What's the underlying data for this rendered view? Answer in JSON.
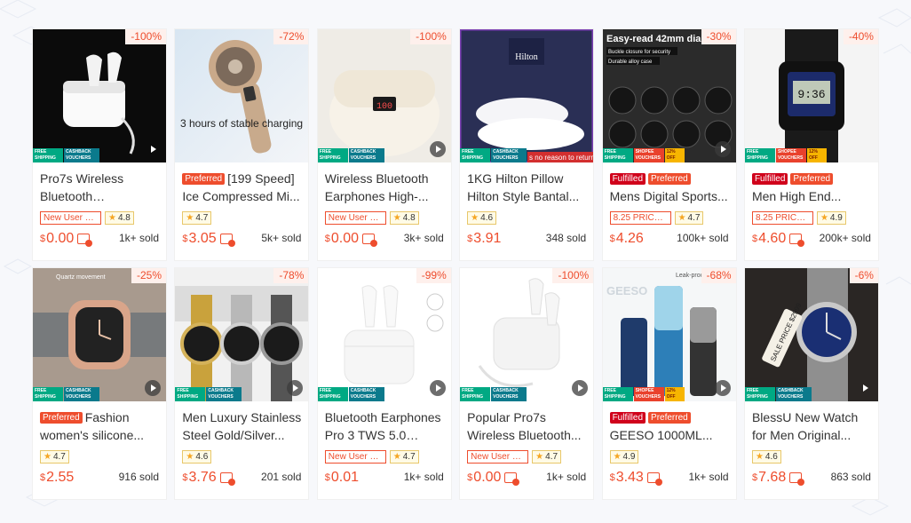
{
  "strip": {
    "s1": "FREE SHIPPING",
    "s2": "CASHBACK VOUCHERS",
    "s3": "SHOPEE VOUCHERS",
    "s4": "12% OFF"
  },
  "products": [
    {
      "discount": "-100%",
      "title": "Pro7s Wireless Bluetooth Earphone...",
      "label": "New User Ex...",
      "rating": "4.8",
      "currency": "$",
      "price": "0.00",
      "sold": "1k+ sold",
      "tags": []
    },
    {
      "discount": "-72%",
      "title": "[199 Speed] Ice Compressed Mi...",
      "label": "",
      "rating": "4.7",
      "currency": "$",
      "price": "3.05",
      "sold": "5k+ sold",
      "tags": [
        "Preferred"
      ]
    },
    {
      "discount": "-100%",
      "title": "Wireless Bluetooth Earphones High-...",
      "label": "New User Ex...",
      "rating": "4.8",
      "currency": "$",
      "price": "0.00",
      "sold": "3k+ sold",
      "tags": []
    },
    {
      "discount": "",
      "title": "1KG Hilton Pillow Hilton Style Bantal...",
      "label": "",
      "rating": "4.6",
      "currency": "$",
      "price": "3.91",
      "sold": "348 sold",
      "tags": []
    },
    {
      "discount": "-30%",
      "title": "Mens Digital Sports...",
      "label": "8.25 PRICE: ...",
      "rating": "4.7",
      "currency": "$",
      "price": "4.26",
      "sold": "100k+ sold",
      "tags": [
        "Fulfilled",
        "Preferred"
      ]
    },
    {
      "discount": "-40%",
      "title": "Men High End...",
      "label": "8.25 PRICE: ...",
      "rating": "4.9",
      "currency": "$",
      "price": "4.60",
      "sold": "200k+ sold",
      "tags": [
        "Fulfilled",
        "Preferred"
      ]
    },
    {
      "discount": "-25%",
      "title": "Fashion women's silicone...",
      "label": "",
      "rating": "4.7",
      "currency": "$",
      "price": "2.55",
      "sold": "916 sold",
      "tags": [
        "Preferred"
      ]
    },
    {
      "discount": "-78%",
      "title": "Men Luxury Stainless Steel Gold/Silver...",
      "label": "",
      "rating": "4.6",
      "currency": "$",
      "price": "3.76",
      "sold": "201 sold",
      "tags": []
    },
    {
      "discount": "-99%",
      "title": "Bluetooth Earphones Pro 3 TWS 5.0 Touc...",
      "label": "New User Ex...",
      "rating": "4.7",
      "currency": "$",
      "price": "0.01",
      "sold": "1k+ sold",
      "tags": []
    },
    {
      "discount": "-100%",
      "title": "Popular Pro7s Wireless Bluetooth...",
      "label": "New User Ex...",
      "rating": "4.7",
      "currency": "$",
      "price": "0.00",
      "sold": "1k+ sold",
      "tags": []
    },
    {
      "discount": "-68%",
      "title": "GEESO 1000ML...",
      "label": "",
      "rating": "4.9",
      "currency": "$",
      "price": "3.43",
      "sold": "1k+ sold",
      "tags": [
        "Fulfilled",
        "Preferred"
      ]
    },
    {
      "discount": "-6%",
      "title": "BlessU New Watch for Men Original...",
      "label": "",
      "rating": "4.6",
      "currency": "$",
      "price": "7.68",
      "sold": "863 sold",
      "tags": []
    }
  ],
  "image_text": {
    "p2": "3 hours of stable charging",
    "p3": "100",
    "p4_brand": "Hilton",
    "p4_strip": "s no reason to return",
    "p5_head": "Easy-read 42mm dia",
    "p5_b1": "Buckle closure for security",
    "p5_b2": "Durable alloy case",
    "p6": "9:36",
    "p7": "Quartz movement",
    "p11_brand": "GEESO",
    "p11_tag": "Leak-proo",
    "p12": "SALE PRICE $2999"
  },
  "colors": {
    "accent": "#ee4d2d",
    "fulfilled": "#d0011b"
  }
}
